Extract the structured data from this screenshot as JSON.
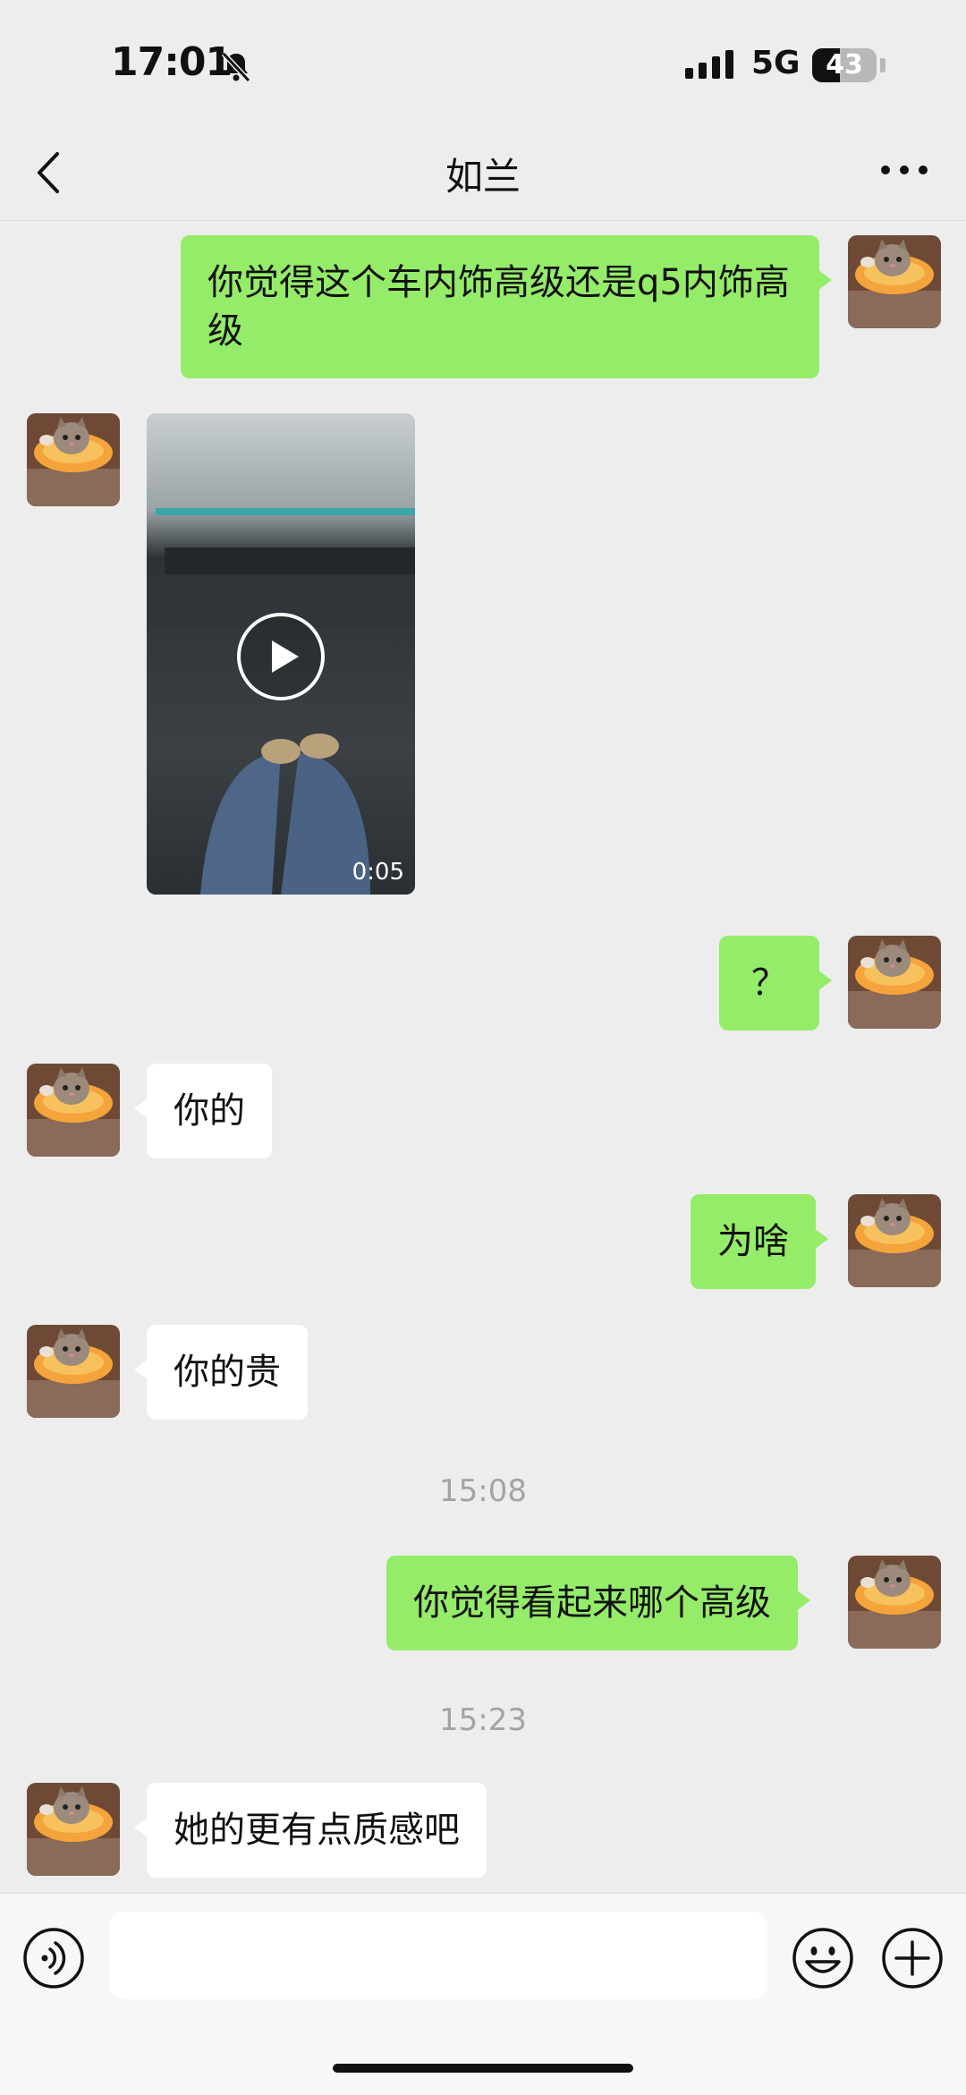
{
  "status_bar": {
    "time": "17:01",
    "network": "5G",
    "battery": "43",
    "battery_level": 0.43,
    "signal_bars": 4
  },
  "header": {
    "title": "如兰"
  },
  "messages": {
    "m1": {
      "text": "你觉得这个车内饰高级还是q5内饰高级"
    },
    "video": {
      "duration": "0:05"
    },
    "m3": {
      "text": "？"
    },
    "m4": {
      "text": "你的"
    },
    "m5": {
      "text": "为啥"
    },
    "m6": {
      "text": "你的贵"
    },
    "ts1": "15:08",
    "m7": {
      "text": "你觉得看起来哪个高级"
    },
    "ts2": "15:23",
    "m8": {
      "text": "她的更有点质感吧"
    }
  },
  "input_bar": {
    "input_value": ""
  },
  "colors": {
    "background": "#ededed",
    "my_bubble": "#95ec69",
    "their_bubble": "#ffffff",
    "timestamp": "#a3a3a3"
  },
  "icons": {
    "voice": "voice-icon",
    "emoji": "emoji-icon",
    "plus": "plus-icon",
    "back": "back-icon",
    "more": "more-icon",
    "mute": "bell-slash-icon",
    "play": "play-icon"
  }
}
